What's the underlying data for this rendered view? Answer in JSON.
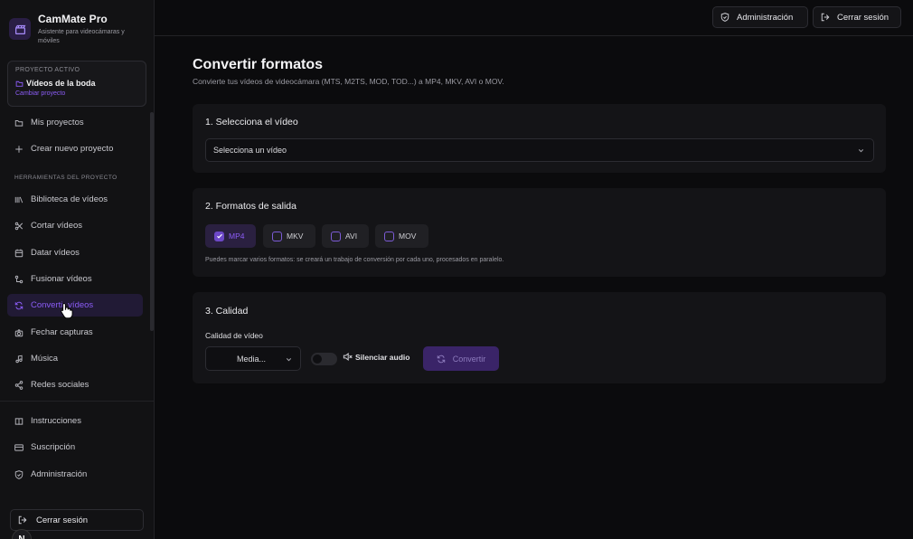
{
  "app": {
    "title": "CamMate Pro",
    "subtitle": "Asistente para videocámaras y móviles"
  },
  "project": {
    "kicker": "PROYECTO ACTIVO",
    "name": "Vídeos de la boda",
    "change_label": "Cambiar proyecto"
  },
  "sidebar": {
    "top_items": [
      {
        "label": "Mis proyectos",
        "icon": "folder-icon"
      },
      {
        "label": "Crear nuevo proyecto",
        "icon": "plus-icon"
      }
    ],
    "section_label": "HERRAMIENTAS DEL PROYECTO",
    "tools": [
      {
        "label": "Biblioteca de vídeos",
        "icon": "library-icon"
      },
      {
        "label": "Cortar vídeos",
        "icon": "scissors-icon"
      },
      {
        "label": "Datar vídeos",
        "icon": "calendar-icon"
      },
      {
        "label": "Fusionar vídeos",
        "icon": "merge-icon"
      },
      {
        "label": "Convertir vídeos",
        "icon": "refresh-icon",
        "active": true
      },
      {
        "label": "Fechar capturas",
        "icon": "camera-icon"
      },
      {
        "label": "Música",
        "icon": "music-icon"
      },
      {
        "label": "Redes sociales",
        "icon": "share-icon"
      }
    ],
    "bottom_items": [
      {
        "label": "Instrucciones",
        "icon": "book-icon"
      },
      {
        "label": "Suscripción",
        "icon": "credit-card-icon"
      },
      {
        "label": "Administración",
        "icon": "shield-icon"
      }
    ],
    "logout_label": "Cerrar sesión",
    "avatar_letter": "N"
  },
  "topbar": {
    "admin_label": "Administración",
    "logout_label": "Cerrar sesión"
  },
  "page": {
    "title": "Convertir formatos",
    "subtitle": "Convierte tus vídeos de videocámara (MTS, M2TS, MOD, TOD...) a MP4, MKV, AVI o MOV."
  },
  "step1": {
    "title": "1. Selecciona el vídeo",
    "select_value": "Selecciona un vídeo"
  },
  "step2": {
    "title": "2. Formatos de salida",
    "formats": [
      {
        "label": "MP4",
        "checked": true
      },
      {
        "label": "MKV",
        "checked": false
      },
      {
        "label": "AVI",
        "checked": false
      },
      {
        "label": "MOV",
        "checked": false
      }
    ],
    "hint": "Puedes marcar varios formatos: se creará un trabajo de conversión por cada uno, procesados en paralelo."
  },
  "step3": {
    "title": "3. Calidad",
    "quality_label": "Calidad de vídeo",
    "quality_value": "Media...",
    "mute_label": "Silenciar audio",
    "mute_on": false,
    "convert_label": "Convertir"
  },
  "colors": {
    "accent": "#8b5cf6",
    "background": "#0b0b0d",
    "card": "#141417"
  }
}
